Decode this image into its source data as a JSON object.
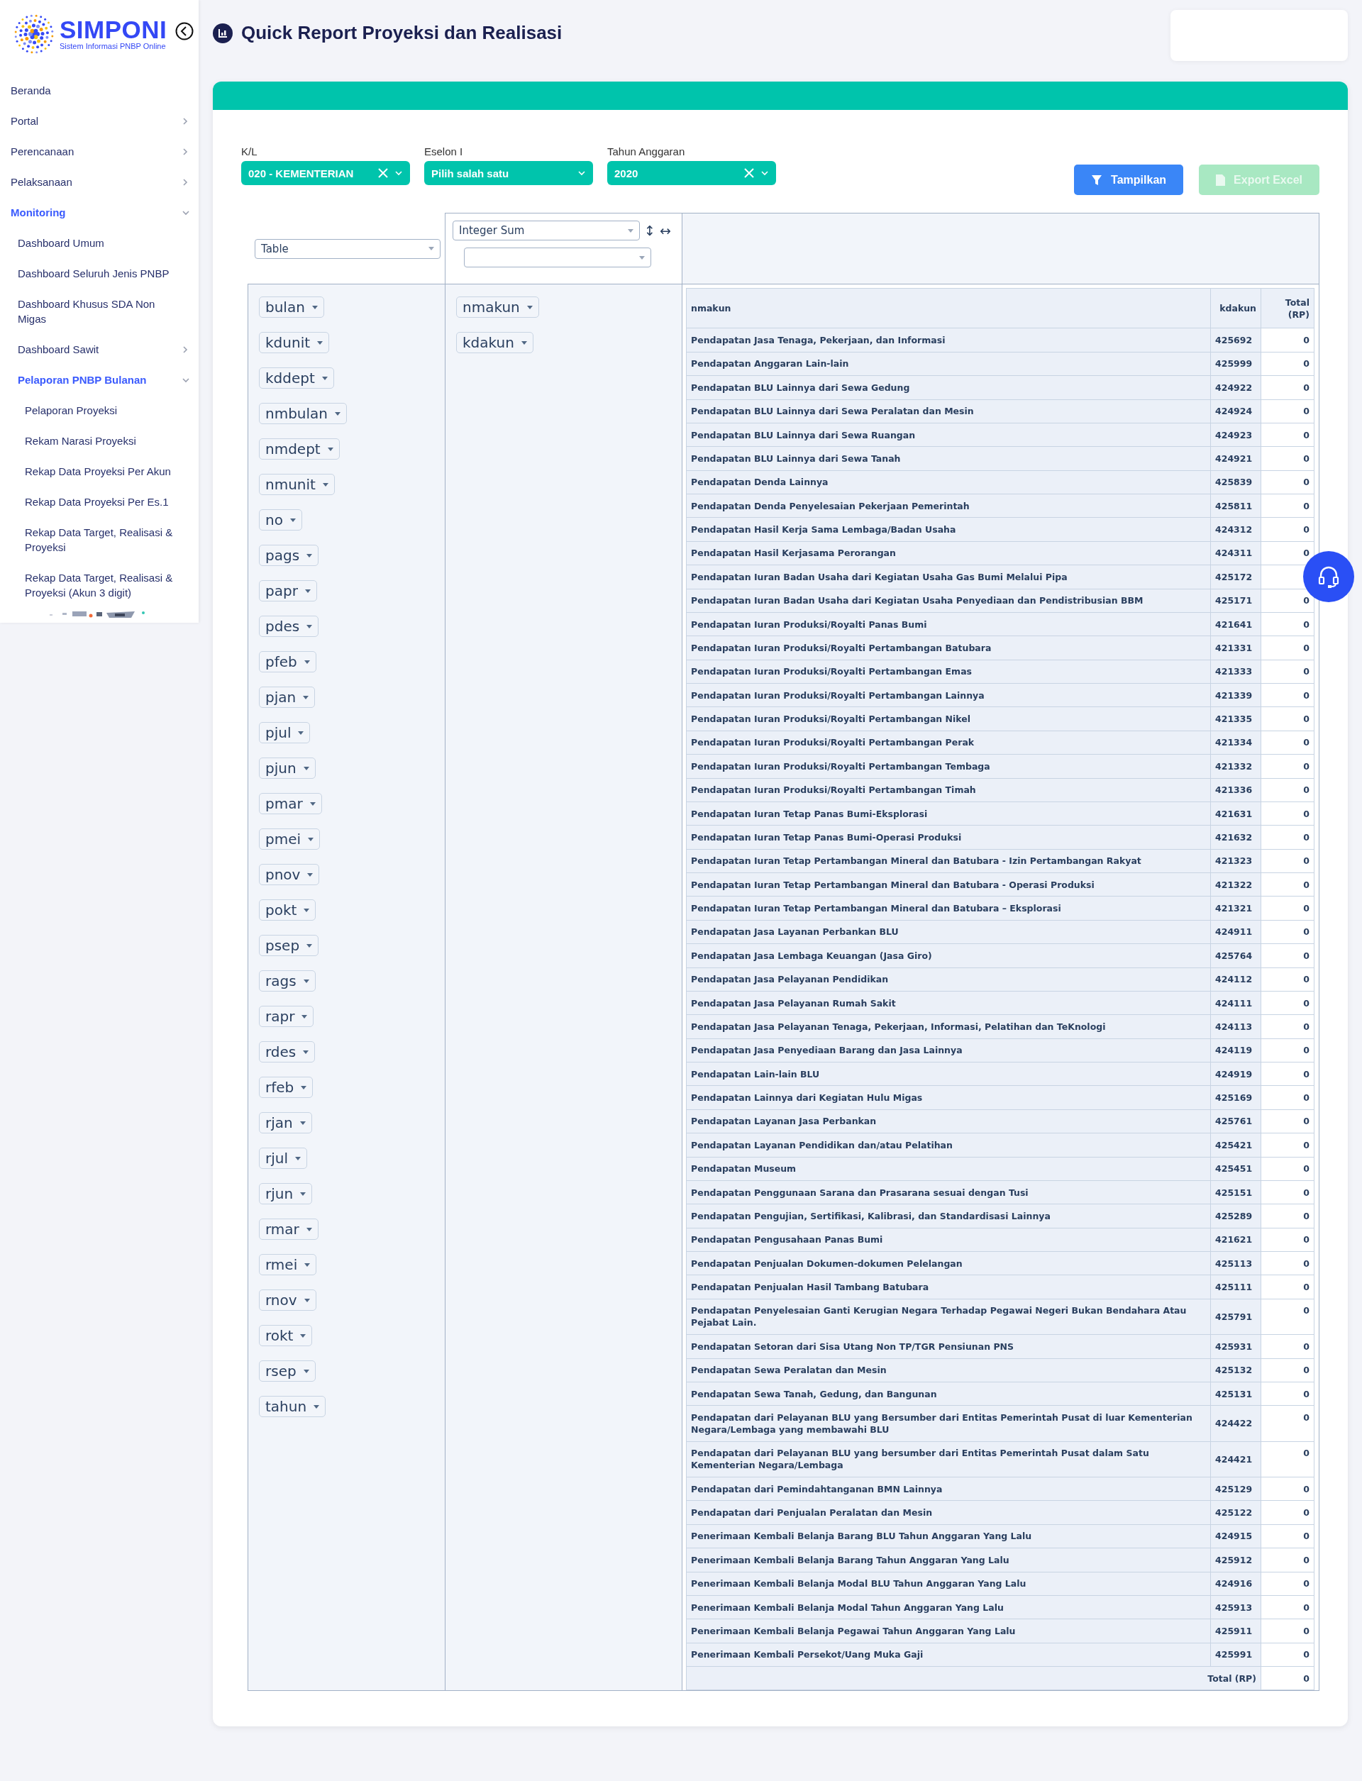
{
  "logo": {
    "name": "SIMPONI",
    "tagline": "Sistem Informasi PNBP Online"
  },
  "sidebar": {
    "items": [
      {
        "label": "Beranda",
        "kind": "link"
      },
      {
        "label": "Portal",
        "kind": "group",
        "expanded": false
      },
      {
        "label": "Perencanaan",
        "kind": "group",
        "expanded": false
      },
      {
        "label": "Pelaksanaan",
        "kind": "group",
        "expanded": false
      },
      {
        "label": "Monitoring",
        "kind": "group",
        "expanded": true,
        "children": [
          {
            "label": "Dashboard Umum",
            "kind": "link"
          },
          {
            "label": "Dashboard Seluruh Jenis PNBP",
            "kind": "link"
          },
          {
            "label": "Dashboard Khusus SDA Non Migas",
            "kind": "link"
          },
          {
            "label": "Dashboard Sawit",
            "kind": "group",
            "expanded": false
          },
          {
            "label": "Pelaporan PNBP Bulanan",
            "kind": "group",
            "expanded": true,
            "children": [
              {
                "label": "Pelaporan Proyeksi",
                "kind": "link"
              },
              {
                "label": "Rekam Narasi Proyeksi",
                "kind": "link"
              },
              {
                "label": "Rekap Data Proyeksi Per Akun",
                "kind": "link"
              },
              {
                "label": "Rekap Data Proyeksi Per Es.1",
                "kind": "link"
              },
              {
                "label": "Rekap Data Target, Realisasi & Proyeksi",
                "kind": "link"
              },
              {
                "label": "Rekap Data Target, Realisasi & Proyeksi (Akun 3 digit)",
                "kind": "link"
              }
            ]
          }
        ]
      }
    ]
  },
  "page": {
    "title": "Quick Report Proyeksi dan Realisasi"
  },
  "filters": [
    {
      "label": "K/L",
      "value": "020 - KEMENTERIAN",
      "clearable": true
    },
    {
      "label": "Eselon I",
      "placeholder": "Pilih salah satu",
      "clearable": false
    },
    {
      "label": "Tahun Anggaran",
      "value": "2020",
      "clearable": true
    }
  ],
  "buttons": [
    {
      "label": "Tampilkan",
      "kind": "filter",
      "disabled": false
    },
    {
      "label": "Export Excel",
      "kind": "export",
      "disabled": true
    }
  ],
  "pivot": {
    "renderer": "Table",
    "aggregator": "Integer Sum",
    "sort_icons": [
      "↕",
      "↔"
    ],
    "unused_attributes": [
      "bulan",
      "kdunit",
      "kddept",
      "nmbulan",
      "nmdept",
      "nmunit",
      "no",
      "pags",
      "papr",
      "pdes",
      "pfeb",
      "pjan",
      "pjul",
      "pjun",
      "pmar",
      "pmei",
      "pnov",
      "pokt",
      "psep",
      "rags",
      "rapr",
      "rdes",
      "rfeb",
      "rjan",
      "rjul",
      "rjun",
      "rmar",
      "rmei",
      "rnov",
      "rokt",
      "rsep",
      "tahun"
    ],
    "row_attributes": [
      "nmakun",
      "kdakun"
    ],
    "table": {
      "columns": [
        "nmakun",
        "kdakun",
        "Total (RP)"
      ],
      "rows": [
        {
          "nmakun": "Pendapatan Jasa Tenaga, Pekerjaan, dan Informasi",
          "kdakun": "425692",
          "total": "0"
        },
        {
          "nmakun": "Pendapatan Anggaran Lain-lain",
          "kdakun": "425999",
          "total": "0"
        },
        {
          "nmakun": "Pendapatan BLU Lainnya dari Sewa Gedung",
          "kdakun": "424922",
          "total": "0"
        },
        {
          "nmakun": "Pendapatan BLU Lainnya dari Sewa Peralatan dan Mesin",
          "kdakun": "424924",
          "total": "0"
        },
        {
          "nmakun": "Pendapatan BLU Lainnya dari Sewa Ruangan",
          "kdakun": "424923",
          "total": "0"
        },
        {
          "nmakun": "Pendapatan BLU Lainnya dari Sewa Tanah",
          "kdakun": "424921",
          "total": "0"
        },
        {
          "nmakun": "Pendapatan Denda Lainnya",
          "kdakun": "425839",
          "total": "0"
        },
        {
          "nmakun": "Pendapatan Denda Penyelesaian Pekerjaan Pemerintah",
          "kdakun": "425811",
          "total": "0"
        },
        {
          "nmakun": "Pendapatan Hasil Kerja Sama Lembaga/Badan Usaha",
          "kdakun": "424312",
          "total": "0"
        },
        {
          "nmakun": "Pendapatan Hasil Kerjasama Perorangan",
          "kdakun": "424311",
          "total": "0"
        },
        {
          "nmakun": "Pendapatan Iuran Badan Usaha dari Kegiatan Usaha Gas Bumi Melalui Pipa",
          "kdakun": "425172"
        },
        {
          "nmakun": "Pendapatan Iuran Badan Usaha dari Kegiatan Usaha Penyediaan dan Pendistribusian BBM",
          "kdakun": "425171",
          "total": "0"
        },
        {
          "nmakun": "Pendapatan Iuran Produksi/Royalti Panas Bumi",
          "kdakun": "421641",
          "total": "0"
        },
        {
          "nmakun": "Pendapatan Iuran Produksi/Royalti Pertambangan Batubara",
          "kdakun": "421331",
          "total": "0"
        },
        {
          "nmakun": "Pendapatan Iuran Produksi/Royalti Pertambangan Emas",
          "kdakun": "421333",
          "total": "0"
        },
        {
          "nmakun": "Pendapatan Iuran Produksi/Royalti Pertambangan Lainnya",
          "kdakun": "421339",
          "total": "0"
        },
        {
          "nmakun": "Pendapatan Iuran Produksi/Royalti Pertambangan Nikel",
          "kdakun": "421335",
          "total": "0"
        },
        {
          "nmakun": "Pendapatan Iuran Produksi/Royalti Pertambangan Perak",
          "kdakun": "421334",
          "total": "0"
        },
        {
          "nmakun": "Pendapatan Iuran Produksi/Royalti Pertambangan Tembaga",
          "kdakun": "421332",
          "total": "0"
        },
        {
          "nmakun": "Pendapatan Iuran Produksi/Royalti Pertambangan Timah",
          "kdakun": "421336",
          "total": "0"
        },
        {
          "nmakun": "Pendapatan Iuran Tetap Panas Bumi-Eksplorasi",
          "kdakun": "421631",
          "total": "0"
        },
        {
          "nmakun": "Pendapatan Iuran Tetap Panas Bumi-Operasi Produksi",
          "kdakun": "421632",
          "total": "0"
        },
        {
          "nmakun": "Pendapatan Iuran Tetap Pertambangan Mineral dan Batubara - Izin Pertambangan Rakyat",
          "kdakun": "421323",
          "total": "0"
        },
        {
          "nmakun": "Pendapatan Iuran Tetap Pertambangan Mineral dan Batubara - Operasi Produksi",
          "kdakun": "421322",
          "total": "0"
        },
        {
          "nmakun": "Pendapatan Iuran Tetap Pertambangan Mineral dan Batubara – Eksplorasi",
          "kdakun": "421321",
          "total": "0"
        },
        {
          "nmakun": "Pendapatan Jasa Layanan Perbankan BLU",
          "kdakun": "424911",
          "total": "0"
        },
        {
          "nmakun": "Pendapatan Jasa Lembaga Keuangan (Jasa Giro)",
          "kdakun": "425764",
          "total": "0"
        },
        {
          "nmakun": "Pendapatan Jasa Pelayanan Pendidikan",
          "kdakun": "424112",
          "total": "0"
        },
        {
          "nmakun": "Pendapatan Jasa Pelayanan Rumah Sakit",
          "kdakun": "424111",
          "total": "0"
        },
        {
          "nmakun": "Pendapatan Jasa Pelayanan Tenaga, Pekerjaan, Informasi, Pelatihan dan TeKnologi",
          "kdakun": "424113",
          "total": "0"
        },
        {
          "nmakun": "Pendapatan Jasa Penyediaan Barang dan Jasa Lainnya",
          "kdakun": "424119",
          "total": "0"
        },
        {
          "nmakun": "Pendapatan Lain-lain BLU",
          "kdakun": "424919",
          "total": "0"
        },
        {
          "nmakun": "Pendapatan Lainnya dari Kegiatan Hulu Migas",
          "kdakun": "425169",
          "total": "0"
        },
        {
          "nmakun": "Pendapatan Layanan Jasa Perbankan",
          "kdakun": "425761",
          "total": "0"
        },
        {
          "nmakun": "Pendapatan Layanan Pendidikan dan/atau Pelatihan",
          "kdakun": "425421",
          "total": "0"
        },
        {
          "nmakun": "Pendapatan Museum",
          "kdakun": "425451",
          "total": "0"
        },
        {
          "nmakun": "Pendapatan Penggunaan Sarana dan Prasarana sesuai dengan Tusi",
          "kdakun": "425151",
          "total": "0"
        },
        {
          "nmakun": "Pendapatan Pengujian, Sertifikasi, Kalibrasi, dan Standardisasi Lainnya",
          "kdakun": "425289",
          "total": "0"
        },
        {
          "nmakun": "Pendapatan Pengusahaan Panas Bumi",
          "kdakun": "421621",
          "total": "0"
        },
        {
          "nmakun": "Pendapatan Penjualan Dokumen-dokumen Pelelangan",
          "kdakun": "425113",
          "total": "0"
        },
        {
          "nmakun": "Pendapatan Penjualan Hasil Tambang Batubara",
          "kdakun": "425111",
          "total": "0"
        },
        {
          "nmakun": "Pendapatan Penyelesaian Ganti Kerugian Negara Terhadap Pegawai Negeri Bukan Bendahara Atau Pejabat Lain.",
          "kdakun": "425791",
          "total": "0"
        },
        {
          "nmakun": "Pendapatan Setoran dari Sisa Utang Non TP/TGR Pensiunan PNS",
          "kdakun": "425931",
          "total": "0"
        },
        {
          "nmakun": "Pendapatan Sewa Peralatan dan Mesin",
          "kdakun": "425132",
          "total": "0"
        },
        {
          "nmakun": "Pendapatan Sewa Tanah, Gedung, dan Bangunan",
          "kdakun": "425131",
          "total": "0"
        },
        {
          "nmakun": "Pendapatan dari Pelayanan BLU yang Bersumber dari Entitas Pemerintah Pusat di luar Kementerian Negara/Lembaga yang membawahi BLU",
          "kdakun": "424422",
          "total": "0"
        },
        {
          "nmakun": "Pendapatan dari Pelayanan BLU yang bersumber dari Entitas Pemerintah Pusat dalam Satu Kementerian Negara/Lembaga",
          "kdakun": "424421",
          "total": "0"
        },
        {
          "nmakun": "Pendapatan dari Pemindahtanganan BMN Lainnya",
          "kdakun": "425129",
          "total": "0"
        },
        {
          "nmakun": "Pendapatan dari Penjualan Peralatan dan Mesin",
          "kdakun": "425122",
          "total": "0"
        },
        {
          "nmakun": "Penerimaan Kembali Belanja Barang BLU Tahun Anggaran Yang Lalu",
          "kdakun": "424915",
          "total": "0"
        },
        {
          "nmakun": "Penerimaan Kembali Belanja Barang Tahun Anggaran Yang Lalu",
          "kdakun": "425912",
          "total": "0"
        },
        {
          "nmakun": "Penerimaan Kembali Belanja Modal BLU Tahun Anggaran Yang Lalu",
          "kdakun": "424916",
          "total": "0"
        },
        {
          "nmakun": "Penerimaan Kembali Belanja Modal Tahun Anggaran Yang Lalu",
          "kdakun": "425913",
          "total": "0"
        },
        {
          "nmakun": "Penerimaan Kembali Belanja Pegawai Tahun Anggaran Yang Lalu",
          "kdakun": "425911",
          "total": "0"
        },
        {
          "nmakun": "Penerimaan Kembali Persekot/Uang Muka Gaji",
          "kdakun": "425991",
          "total": "0"
        }
      ],
      "total_label": "Total (RP)",
      "grand_total": "0"
    }
  }
}
